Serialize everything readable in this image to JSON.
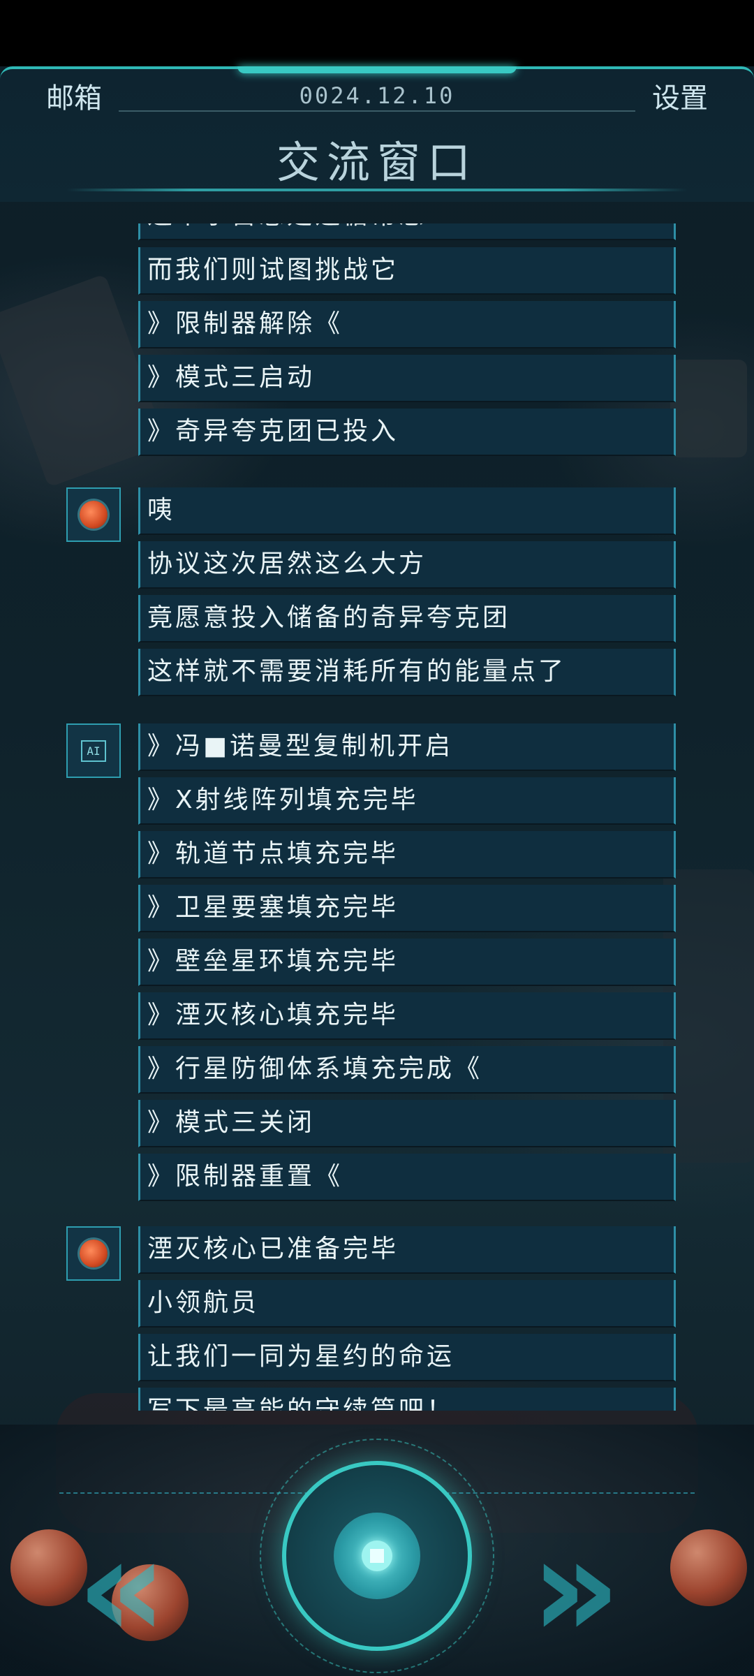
{
  "header": {
    "mail_label": "邮箱",
    "date": "0024.12.10",
    "settings_label": "设置",
    "title": "交流窗口"
  },
  "messages": [
    {
      "avatar": "partial",
      "lines": [
        "这个宇宙总是遵循常态"
      ]
    },
    {
      "avatar": "none",
      "lines": [
        "而我们则试图挑战它",
        "》限制器解除《",
        "》模式三启动",
        "》奇异夸克团已投入"
      ]
    },
    {
      "avatar": "red-brain-icon",
      "lines": [
        "咦",
        "协议这次居然这么大方",
        "竟愿意投入储备的奇异夸克团",
        "这样就不需要消耗所有的能量点了"
      ]
    },
    {
      "avatar": "ai-chip-icon",
      "lines": [
        "》冯■诺曼型复制机开启",
        "》X射线阵列填充完毕",
        "》轨道节点填充完毕",
        "》卫星要塞填充完毕",
        "》壁垒星环填充完毕",
        "》湮灭核心填充完毕",
        "》行星防御体系填充完成《",
        "》模式三关闭",
        "》限制器重置《"
      ]
    },
    {
      "avatar": "red-brain-icon",
      "lines": [
        "湮灭核心已准备完毕",
        "小领航员",
        "让我们一同为星约的命运",
        "写下最高能的守续篇吧！"
      ]
    }
  ],
  "controls": {
    "prev_icon": "double-chevron-left-icon",
    "next_icon": "double-chevron-right-icon",
    "center_icon": "dial-button-icon"
  },
  "colors": {
    "accent": "#39c9c3",
    "bubble_bg": "#0f2e3f",
    "bubble_border": "#2e8fa6"
  }
}
